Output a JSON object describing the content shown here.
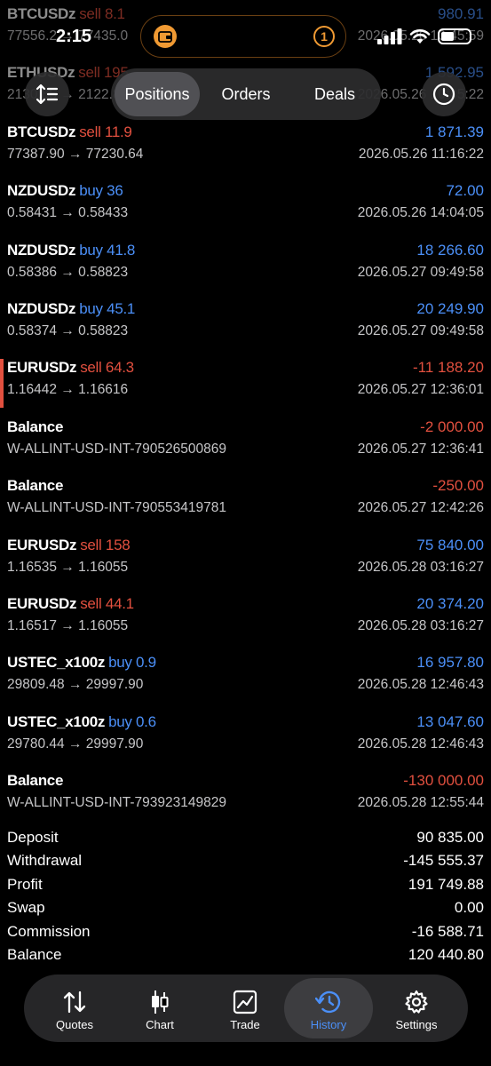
{
  "status_bar": {
    "time": "2:15",
    "notification_count": "1"
  },
  "top_controls": {
    "tabs": [
      {
        "label": "Positions",
        "active": true
      },
      {
        "label": "Orders",
        "active": false
      },
      {
        "label": "Deals",
        "active": false
      }
    ]
  },
  "deals": [
    {
      "symbol": "BTCUSDz",
      "side": "sell",
      "volume": "8.1",
      "sub": "77556.2 → 77435.0",
      "profit": "980.91",
      "sign": "pos",
      "time": "2026.05.26 10:45:59",
      "faded": true
    },
    {
      "symbol": "ETHUSDz",
      "side": "sell",
      "volume": "195",
      "sub": "2130.85 → 2122.80",
      "profit": "1 592.95",
      "sign": "pos",
      "time": "2026.05.26 10:45:22",
      "faded": true
    },
    {
      "symbol": "BTCUSDz",
      "side": "sell",
      "volume": "11.9",
      "sub": "77387.90 → 77230.64",
      "profit": "1 871.39",
      "sign": "pos",
      "time": "2026.05.26 11:16:22"
    },
    {
      "symbol": "NZDUSDz",
      "side": "buy",
      "volume": "36",
      "sub": "0.58431 → 0.58433",
      "profit": "72.00",
      "sign": "pos",
      "time": "2026.05.26 14:04:05"
    },
    {
      "symbol": "NZDUSDz",
      "side": "buy",
      "volume": "41.8",
      "sub": "0.58386 → 0.58823",
      "profit": "18 266.60",
      "sign": "pos",
      "time": "2026.05.27 09:49:58"
    },
    {
      "symbol": "NZDUSDz",
      "side": "buy",
      "volume": "45.1",
      "sub": "0.58374 → 0.58823",
      "profit": "20 249.90",
      "sign": "pos",
      "time": "2026.05.27 09:49:58"
    },
    {
      "symbol": "EURUSDz",
      "side": "sell",
      "volume": "64.3",
      "sub": "1.16442 → 1.16616",
      "profit": "-11 188.20",
      "sign": "neg",
      "time": "2026.05.27 12:36:01",
      "highlight": true
    },
    {
      "symbol": "Balance",
      "side": "",
      "volume": "",
      "sub": "W-ALLINT-USD-INT-790526500869",
      "profit": "-2 000.00",
      "sign": "neg",
      "time": "2026.05.27 12:36:41"
    },
    {
      "symbol": "Balance",
      "side": "",
      "volume": "",
      "sub": "W-ALLINT-USD-INT-790553419781",
      "profit": "-250.00",
      "sign": "neg",
      "time": "2026.05.27 12:42:26"
    },
    {
      "symbol": "EURUSDz",
      "side": "sell",
      "volume": "158",
      "sub": "1.16535 → 1.16055",
      "profit": "75 840.00",
      "sign": "pos",
      "time": "2026.05.28 03:16:27"
    },
    {
      "symbol": "EURUSDz",
      "side": "sell",
      "volume": "44.1",
      "sub": "1.16517 → 1.16055",
      "profit": "20 374.20",
      "sign": "pos",
      "time": "2026.05.28 03:16:27"
    },
    {
      "symbol": "USTEC_x100z",
      "side": "buy",
      "volume": "0.9",
      "sub": "29809.48 → 29997.90",
      "profit": "16 957.80",
      "sign": "pos",
      "time": "2026.05.28 12:46:43"
    },
    {
      "symbol": "USTEC_x100z",
      "side": "buy",
      "volume": "0.6",
      "sub": "29780.44 → 29997.90",
      "profit": "13 047.60",
      "sign": "pos",
      "time": "2026.05.28 12:46:43"
    },
    {
      "symbol": "Balance",
      "side": "",
      "volume": "",
      "sub": "W-ALLINT-USD-INT-793923149829",
      "profit": "-130 000.00",
      "sign": "neg",
      "time": "2026.05.28 12:55:44"
    }
  ],
  "summary": [
    {
      "label": "Deposit",
      "value": "90 835.00"
    },
    {
      "label": "Withdrawal",
      "value": "-145 555.37"
    },
    {
      "label": "Profit",
      "value": "191 749.88"
    },
    {
      "label": "Swap",
      "value": "0.00"
    },
    {
      "label": "Commission",
      "value": "-16 588.71"
    },
    {
      "label": "Balance",
      "value": "120 440.80"
    }
  ],
  "tab_bar": {
    "items": [
      {
        "label": "Quotes",
        "icon": "quotes-arrows-icon",
        "active": false
      },
      {
        "label": "Chart",
        "icon": "candlestick-icon",
        "active": false
      },
      {
        "label": "Trade",
        "icon": "trade-chart-icon",
        "active": false
      },
      {
        "label": "History",
        "icon": "history-clock-icon",
        "active": true
      },
      {
        "label": "Settings",
        "icon": "gear-icon",
        "active": false
      }
    ]
  },
  "colors": {
    "buy": "#4b8ff7",
    "sell": "#e2503f",
    "accent": "#f09a33",
    "background": "#000000"
  }
}
